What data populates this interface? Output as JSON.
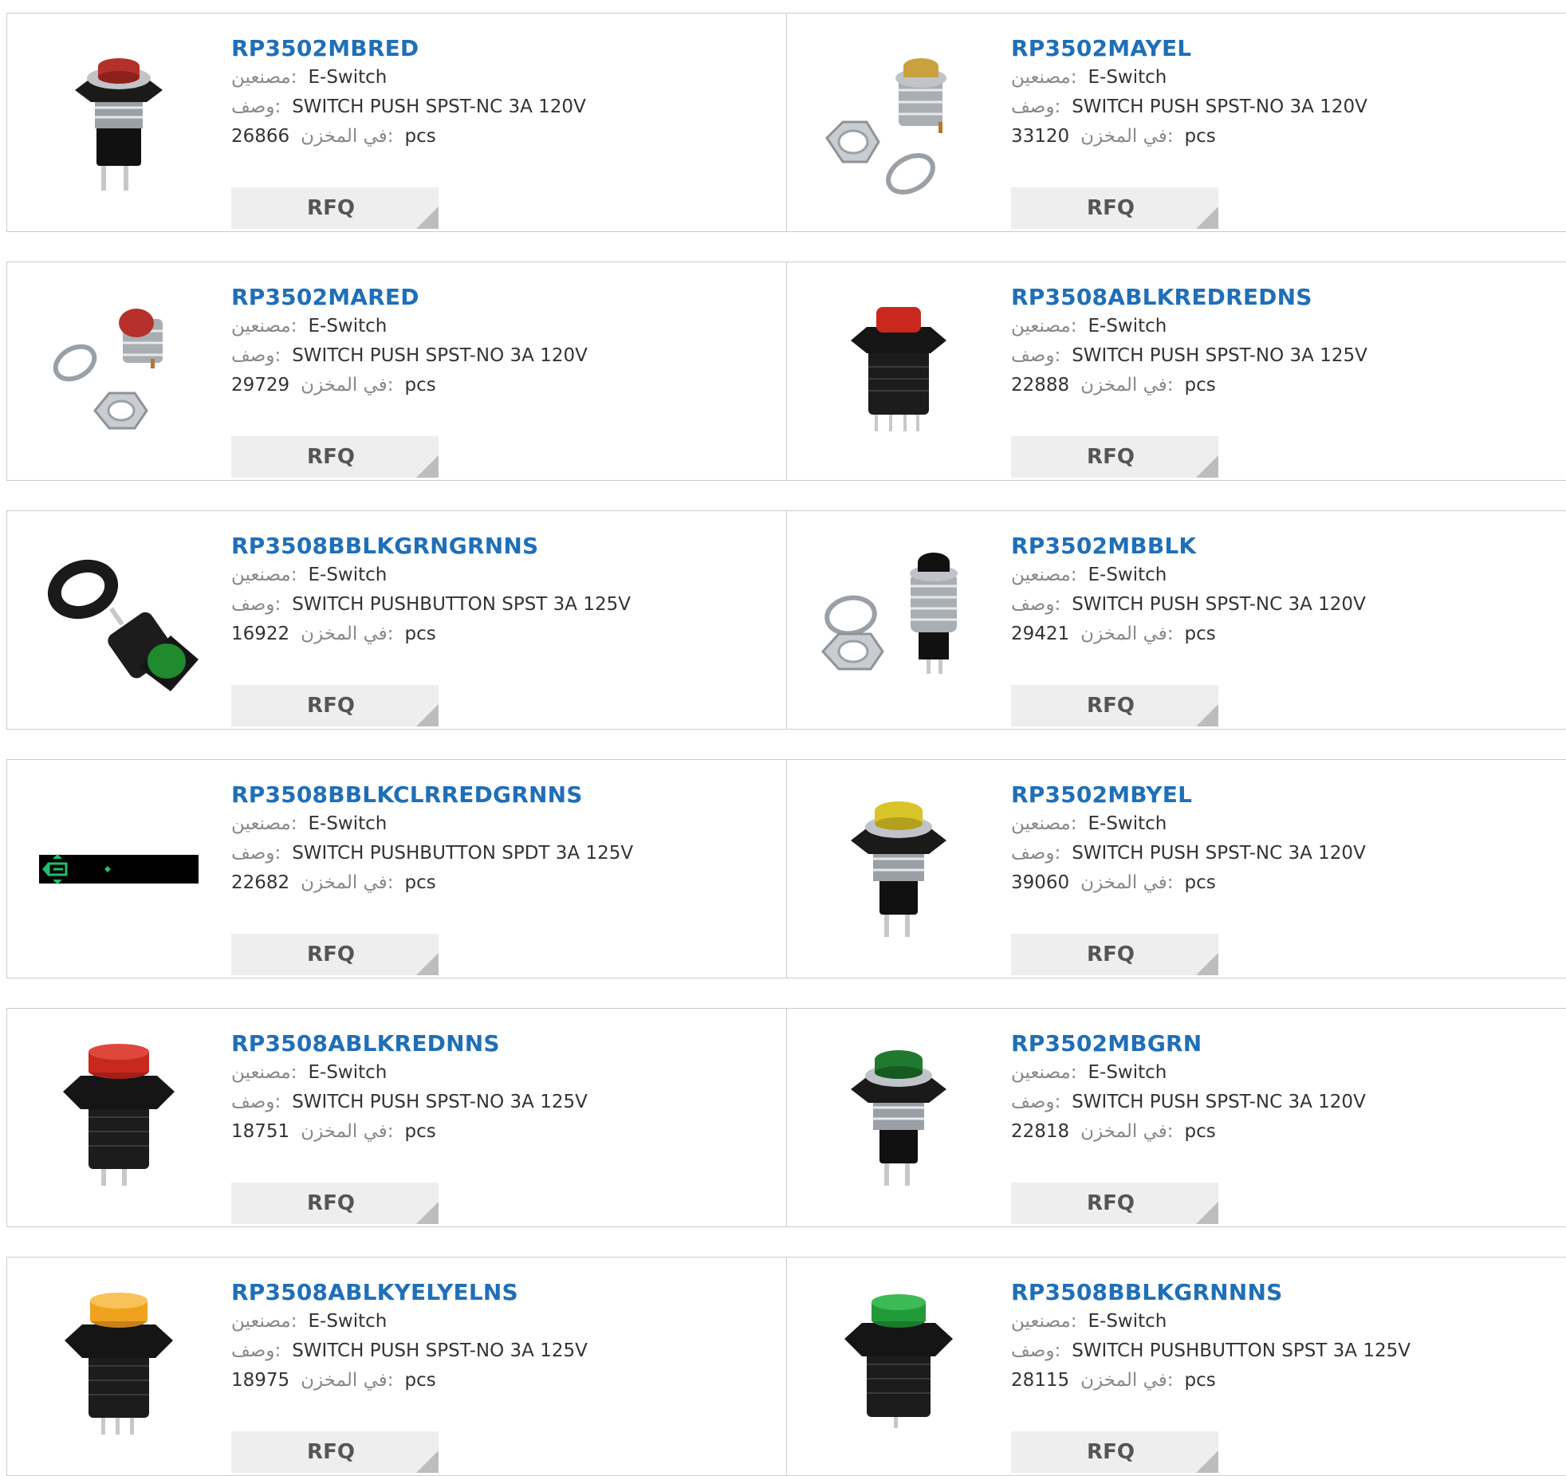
{
  "labels": {
    "manufacturer": "مصنعين:",
    "description": "وصف:",
    "stock": "في المخزن:",
    "unit": "pcs",
    "rfq": "RFQ"
  },
  "products": [
    {
      "part": "RP3502MBRED",
      "manufacturer": "E-Switch",
      "description": "SWITCH PUSH SPST-NC 3A 120V",
      "stock": "26866",
      "image": "metal-round-red-button-icon",
      "cap_color": "#b5302a"
    },
    {
      "part": "RP3502MAYEL",
      "manufacturer": "E-Switch",
      "description": "SWITCH PUSH SPST-NO 3A 120V",
      "stock": "33120",
      "image": "metal-button-with-nut-and-washer-icon",
      "cap_color": "#c9a13e"
    },
    {
      "part": "RP3502MARED",
      "manufacturer": "E-Switch",
      "description": "SWITCH PUSH SPST-NO 3A 120V",
      "stock": "29729",
      "image": "metal-button-with-nut-and-washer-icon",
      "cap_color": "#b5302a"
    },
    {
      "part": "RP3508ABLKREDREDNS",
      "manufacturer": "E-Switch",
      "description": "SWITCH PUSH SPST-NO 3A 125V",
      "stock": "22888",
      "image": "black-square-red-button-icon",
      "cap_color": "#c8281e"
    },
    {
      "part": "RP3508BBLKGRNGRNNS",
      "manufacturer": "E-Switch",
      "description": "SWITCH PUSHBUTTON SPST 3A 125V",
      "stock": "16922",
      "image": "black-green-button-with-ring-icon",
      "cap_color": "#1f8a2e"
    },
    {
      "part": "RP3502MBBLK",
      "manufacturer": "E-Switch",
      "description": "SWITCH PUSH SPST-NC 3A 120V",
      "stock": "29421",
      "image": "metal-button-with-nut-and-washer-icon",
      "cap_color": "#111111"
    },
    {
      "part": "RP3508BBLKCLRREDGRNNS",
      "manufacturer": "E-Switch",
      "description": "SWITCH PUSHBUTTON SPDT 3A 125V",
      "stock": "22682",
      "image": "black-strip-placeholder-icon",
      "cap_color": "#1fbf6a"
    },
    {
      "part": "RP3502MBYEL",
      "manufacturer": "E-Switch",
      "description": "SWITCH PUSH SPST-NC 3A 120V",
      "stock": "39060",
      "image": "metal-round-yellow-button-icon",
      "cap_color": "#d9c42a"
    },
    {
      "part": "RP3508ABLKREDNNS",
      "manufacturer": "E-Switch",
      "description": "SWITCH PUSH SPST-NO 3A 125V",
      "stock": "18751",
      "image": "black-square-red-button-icon",
      "cap_color": "#c8281e"
    },
    {
      "part": "RP3502MBGRN",
      "manufacturer": "E-Switch",
      "description": "SWITCH PUSH SPST-NC 3A 120V",
      "stock": "22818",
      "image": "metal-round-green-button-icon",
      "cap_color": "#1f7a30"
    },
    {
      "part": "RP3508ABLKYELYELNS",
      "manufacturer": "E-Switch",
      "description": "SWITCH PUSH SPST-NO 3A 125V",
      "stock": "18975",
      "image": "black-square-orange-button-icon",
      "cap_color": "#f0a21e"
    },
    {
      "part": "RP3508BBLKGRNNNS",
      "manufacturer": "E-Switch",
      "description": "SWITCH PUSHBUTTON SPST 3A 125V",
      "stock": "28115",
      "image": "black-square-green-button-icon",
      "cap_color": "#239a3a"
    }
  ]
}
